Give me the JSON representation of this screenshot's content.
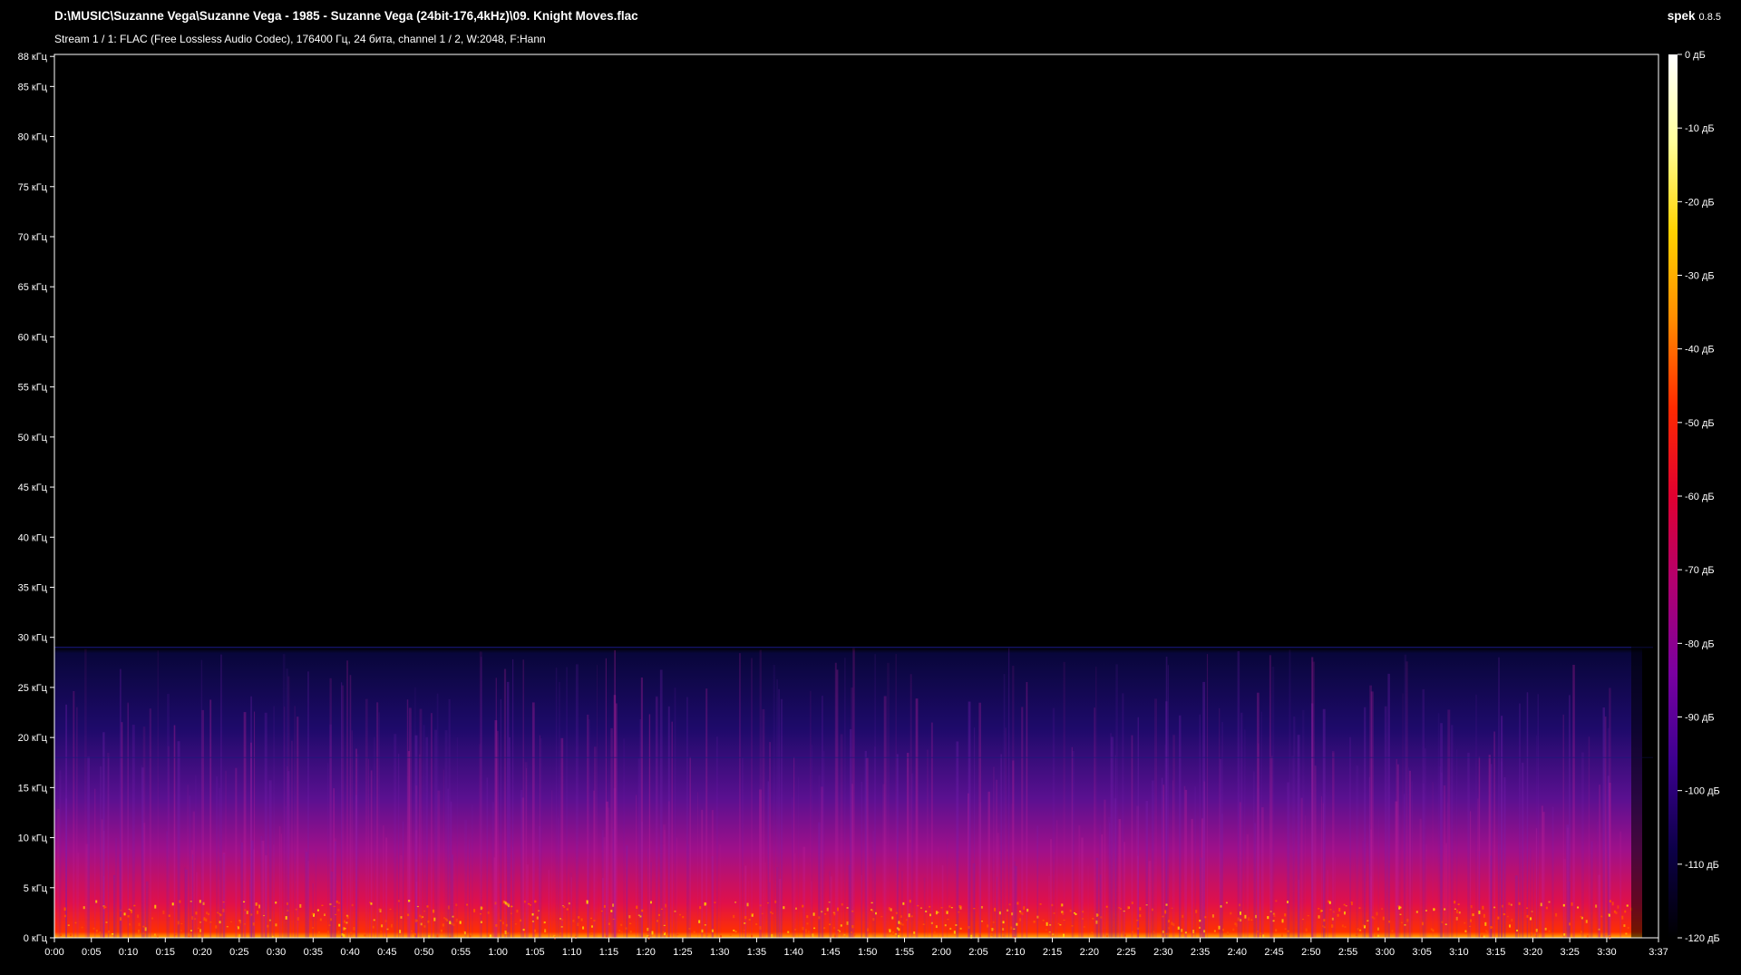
{
  "header": {
    "title": "D:\\MUSIC\\Suzanne Vega\\Suzanne Vega - 1985 - Suzanne Vega (24bit-176,4kHz)\\09. Knight Moves.flac",
    "stream_info": "Stream 1 / 1: FLAC (Free Lossless Audio Codec), 176400 Гц, 24 бита, channel 1 / 2, W:2048, F:Hann",
    "app_name": "spek",
    "app_version": "0.8.5"
  },
  "chart_data": {
    "type": "heatmap",
    "title": "D:\\MUSIC\\Suzanne Vega\\Suzanne Vega - 1985 - Suzanne Vega (24bit-176,4kHz)\\09. Knight Moves.flac",
    "frequency_axis": {
      "tick_labels": [
        "0 кГц",
        "5 кГц",
        "10 кГц",
        "15 кГц",
        "20 кГц",
        "25 кГц",
        "30 кГц",
        "35 кГц",
        "40 кГц",
        "45 кГц",
        "50 кГц",
        "55 кГц",
        "60 кГц",
        "65 кГц",
        "70 кГц",
        "75 кГц",
        "80 кГц",
        "85 кГц",
        "88 кГц"
      ],
      "tick_values_khz": [
        0,
        5,
        10,
        15,
        20,
        25,
        30,
        35,
        40,
        45,
        50,
        55,
        60,
        65,
        70,
        75,
        80,
        85,
        88
      ],
      "range_khz": [
        0,
        88.2
      ]
    },
    "time_axis": {
      "tick_labels": [
        "0:00",
        "0:05",
        "0:10",
        "0:15",
        "0:20",
        "0:25",
        "0:30",
        "0:35",
        "0:40",
        "0:45",
        "0:50",
        "0:55",
        "1:00",
        "1:05",
        "1:10",
        "1:15",
        "1:20",
        "1:25",
        "1:30",
        "1:35",
        "1:40",
        "1:45",
        "1:50",
        "1:55",
        "2:00",
        "2:05",
        "2:10",
        "2:15",
        "2:20",
        "2:25",
        "2:30",
        "2:35",
        "2:40",
        "2:45",
        "2:50",
        "2:55",
        "3:00",
        "3:05",
        "3:10",
        "3:15",
        "3:20",
        "3:25",
        "3:30",
        "3:37"
      ],
      "tick_values_s": [
        0,
        5,
        10,
        15,
        20,
        25,
        30,
        35,
        40,
        45,
        50,
        55,
        60,
        65,
        70,
        75,
        80,
        85,
        90,
        95,
        100,
        105,
        110,
        115,
        120,
        125,
        130,
        135,
        140,
        145,
        150,
        155,
        160,
        165,
        170,
        175,
        180,
        185,
        190,
        195,
        200,
        205,
        210,
        217
      ],
      "range_s": [
        0,
        217
      ]
    },
    "db_scale": {
      "tick_labels": [
        "0 дБ",
        "-10 дБ",
        "-20 дБ",
        "-30 дБ",
        "-40 дБ",
        "-50 дБ",
        "-60 дБ",
        "-70 дБ",
        "-80 дБ",
        "-90 дБ",
        "-100 дБ",
        "-110 дБ",
        "-120 дБ"
      ],
      "tick_values_db": [
        0,
        -10,
        -20,
        -30,
        -40,
        -50,
        -60,
        -70,
        -80,
        -90,
        -100,
        -110,
        -120
      ],
      "range_db": [
        -120,
        0
      ],
      "colors": [
        "#ffffff",
        "#ffff99",
        "#ffd200",
        "#ff8c00",
        "#ff2a00",
        "#e00030",
        "#b00070",
        "#7a00a0",
        "#3c0090",
        "#0c0048",
        "#000000"
      ]
    },
    "content_cutoff_khz": 29,
    "faint_line_khz": 18
  }
}
